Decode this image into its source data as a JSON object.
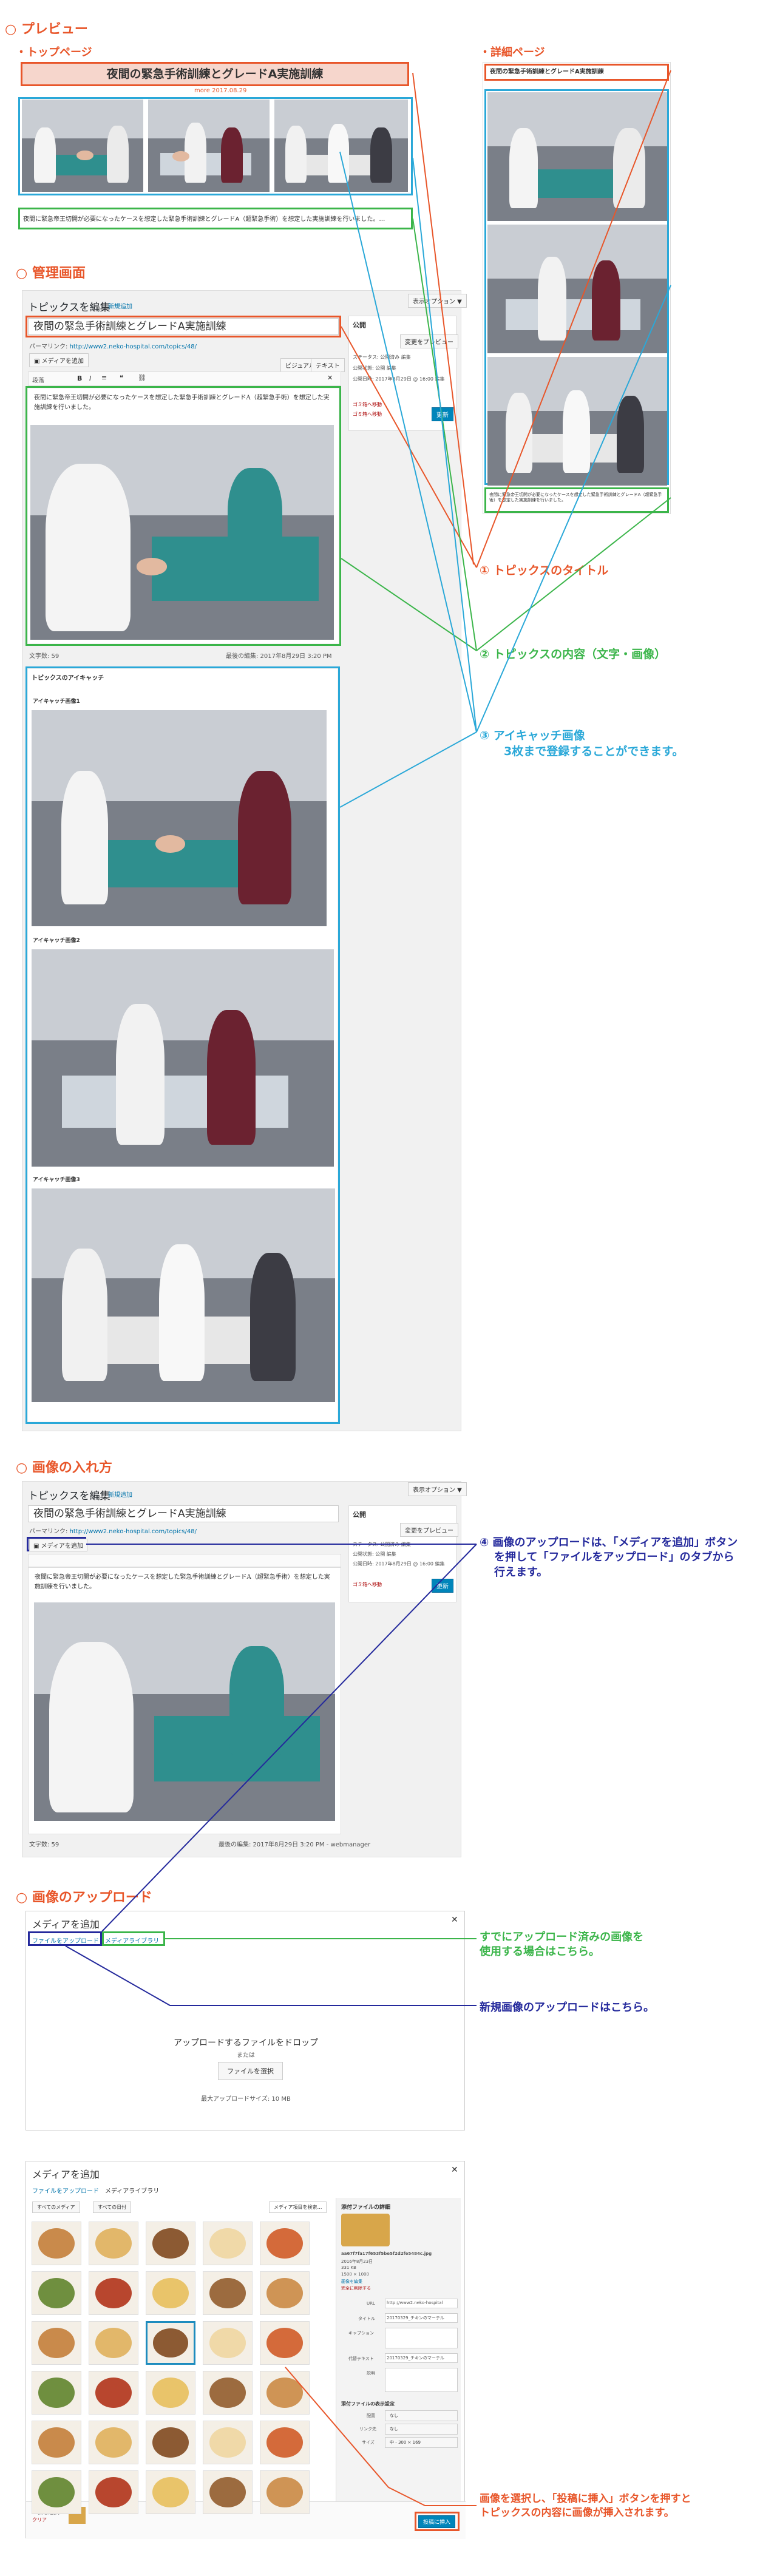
{
  "sections": {
    "preview": "○ プレビュー",
    "admin": "○ 管理画面",
    "insert": "○ 画像の入れ方",
    "upload": "○ 画像のアップロード"
  },
  "subsections": {
    "top_page": "・トップページ",
    "detail_page": "・詳細ページ"
  },
  "preview": {
    "title": "夜間の緊急手術訓練とグレードA実施訓練",
    "date": "more 2017.08.29",
    "excerpt": "夜間に緊急帝王切開が必要になったケースを想定した緊急手術訓練とグレードA（超緊急手術）を想定した実施訓練を行いました。…",
    "detail_title": "夜間の緊急手術訓練とグレードA実施訓練",
    "detail_excerpt": "夜間に緊急帝王切開が必要になったケースを想定した緊急手術訓練とグレードA（超緊急手術）を想定した実施訓練を行いました。"
  },
  "editor": {
    "heading": "トピックスを編集",
    "add_new": "新規追加",
    "title_value": "夜間の緊急手術訓練とグレードA実施訓練",
    "permalink_label": "パーマリンク:",
    "permalink_url": "http://www2.neko-hospital.com/topics/48/",
    "add_media": "メディアを追加",
    "tab_visual": "ビジュアル",
    "tab_text": "テキスト",
    "format_select": "段落",
    "body_text": "夜間に緊急帝王切開が必要になったケースを想定した緊急手術訓練とグレードA（超緊急手術）を想定した実施訓練を行いました。",
    "word_count": "文字数: 59",
    "last_edit": "最後の編集: 2017年8月29日 3:20 PM",
    "last_edit_by": "最後の編集: 2017年8月29日 3:20 PM - webmanager",
    "screen_options": "表示オプション ▼",
    "publish_box": "公開",
    "preview_changes": "変更をプレビュー",
    "status": "ステータス: 公開済み 編集",
    "visibility": "公開状態: 公開 編集",
    "published_on": "公開日時: 2017年8月29日 @ 16:00 編集",
    "trash": "ゴミ箱へ移動",
    "move_to_trash": "ゴミ箱へ移動",
    "update": "更新",
    "featured_box": "トピックスのアイキャッチ",
    "featured1": "アイキャッチ画像1",
    "featured2": "アイキャッチ画像2",
    "featured3": "アイキャッチ画像3"
  },
  "callouts": {
    "c1": "① トピックスのタイトル",
    "c2": "② トピックスの内容（文字・画像）",
    "c3_line1": "③ アイキャッチ画像",
    "c3_line2": "3枚まで登録することができます。",
    "c4_line1": "④ 画像のアップロードは、「メディアを追加」ボタン",
    "c4_line2": "を押して「ファイルをアップロード」のタブから",
    "c4_line3": "行えます。",
    "c5_line1": "すでにアップロード済みの画像を",
    "c5_line2": "使用する場合はこちら。",
    "c6": "新規画像のアップロードはこちら。",
    "c7_line1": "画像を選択し、「投稿に挿入」ボタンを押すと",
    "c7_line2": "トピックスの内容に画像が挿入されます。"
  },
  "media": {
    "title": "メディアを追加",
    "tab_upload": "ファイルをアップロード",
    "tab_library": "メディアライブラリ",
    "drop_text": "アップロードするファイルをドロップ",
    "or": "または",
    "select_file": "ファイルを選択",
    "max_size": "最大アップロードサイズ: 10 MB",
    "filter_all": "すべてのメディア",
    "filter_date": "すべての日付",
    "search_placeholder": "メディア項目を検索…",
    "details_heading": "添付ファイルの詳細",
    "file_name": "aa67f7fa17f653f5be5f2d2fe5484c.jpg",
    "file_date": "2016年8月23日",
    "file_size": "331 KB",
    "file_dims": "1500 × 1000",
    "edit_image": "画像を編集",
    "delete_permanently": "完全に削除する",
    "url_label": "URL",
    "url_value": "http://www2.neko-hospital",
    "title_label": "タイトル",
    "title_value": "20170329_チキンのマーテル",
    "caption_label": "キャプション",
    "alt_label": "代替テキスト",
    "alt_value": "20170329_チキンのマーテル",
    "desc_label": "説明",
    "display_settings": "添付ファイルの表示設定",
    "align_label": "配置",
    "align_value": "なし",
    "link_label": "リンク先",
    "link_value": "なし",
    "size_label": "サイズ",
    "size_value": "中 - 300 × 169",
    "selected_count": "1 個を選択",
    "clear": "クリア",
    "insert_button": "投稿に挿入",
    "close_icon": "close-icon"
  },
  "colors": {
    "orange": "#e8562a",
    "green": "#3bb54a",
    "cyan": "#2aa8d8",
    "navy": "#24299c"
  }
}
